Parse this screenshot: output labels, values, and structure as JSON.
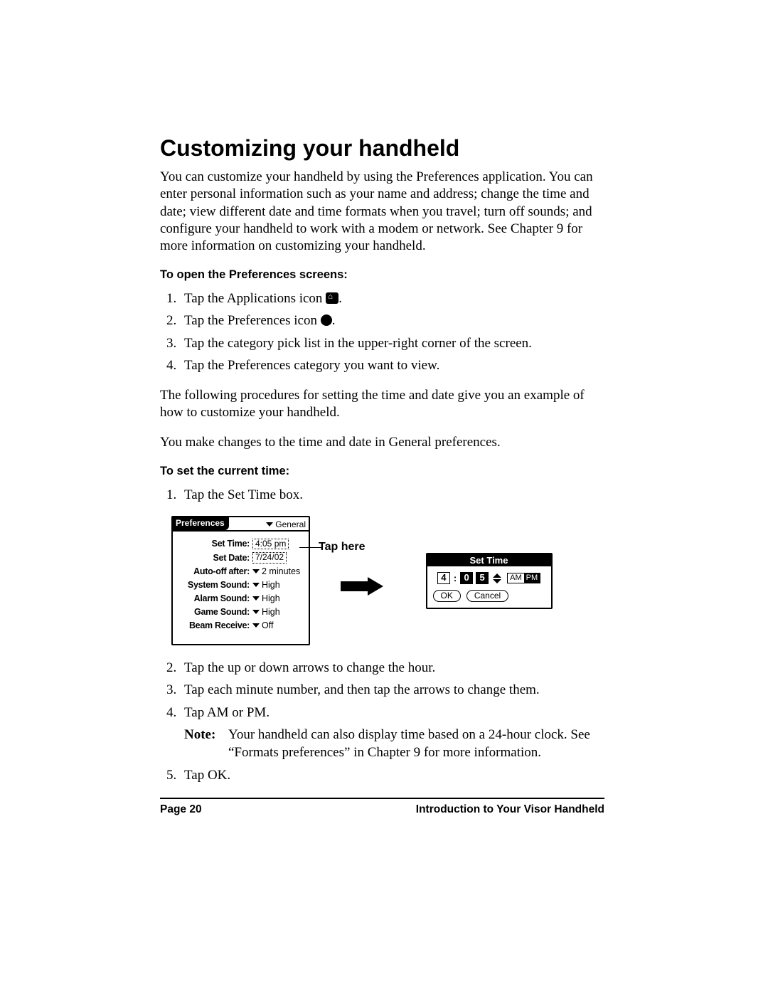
{
  "heading": "Customizing your handheld",
  "intro": "You can customize your handheld by using the Preferences application. You can enter personal information such as your name and address; change the time and date; view different date and time formats when you travel; turn off sounds; and configure your handheld to work with a modem or network. See Chapter 9 for more information on customizing your handheld.",
  "section1_title": "To open the Preferences screens:",
  "steps1": {
    "s1a": "Tap the Applications icon ",
    "s1b": ".",
    "s2a": "Tap the Preferences icon ",
    "s2b": ".",
    "s3": "Tap the category pick list in the upper-right corner of the screen.",
    "s4": "Tap the Preferences category you want to view."
  },
  "para2": "The following procedures for setting the time and date give you an example of how to customize your handheld.",
  "para3": "You make changes to the time and date in General preferences.",
  "section2_title": "To set the current time:",
  "steps2_1": "Tap the Set Time box.",
  "prefs_screen": {
    "title": "Preferences",
    "category": "General",
    "rows": {
      "set_time_label": "Set Time:",
      "set_time_value": "4:05 pm",
      "set_date_label": "Set Date:",
      "set_date_value": "7/24/02",
      "auto_off_label": "Auto-off after:",
      "auto_off_value": "2 minutes",
      "sys_sound_label": "System Sound:",
      "sys_sound_value": "High",
      "alarm_sound_label": "Alarm Sound:",
      "alarm_sound_value": "High",
      "game_sound_label": "Game Sound:",
      "game_sound_value": "High",
      "beam_label": "Beam Receive:",
      "beam_value": "Off"
    }
  },
  "callout": "Tap here",
  "settime_dialog": {
    "title": "Set Time",
    "hour": "4",
    "min_tens": "0",
    "min_ones": "5",
    "am": "AM",
    "pm": "PM",
    "ok": "OK",
    "cancel": "Cancel"
  },
  "steps2_rest": {
    "s2": "Tap the up or down arrows to change the hour.",
    "s3": "Tap each minute number, and then tap the arrows to change them.",
    "s4": "Tap AM or PM.",
    "note_label": "Note:",
    "note_text": "Your handheld can also display time based on a 24-hour clock. See “Formats preferences” in Chapter 9 for more information.",
    "s5": "Tap OK."
  },
  "footer": {
    "left": "Page 20",
    "right": "Introduction to Your Visor Handheld"
  }
}
